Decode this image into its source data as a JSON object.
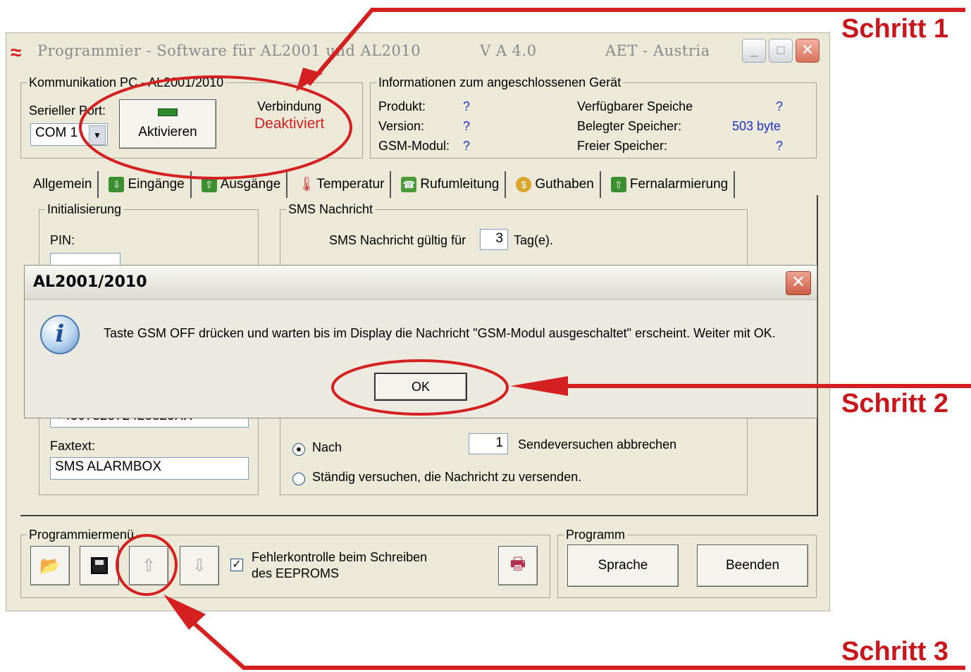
{
  "window": {
    "title_left": "Programmier - Software für AL2001 und AL2010",
    "title_version": "V A 4.0",
    "title_company": "AET - Austria"
  },
  "kommunikation": {
    "legend": "Kommunikation PC - AL2001/2010",
    "port_label": "Serieller Port:",
    "port_value": "COM 1",
    "activate_button": "Aktivieren",
    "verbindung_label": "Verbindung",
    "verbindung_status": "Deaktiviert"
  },
  "geraet": {
    "legend": "Informationen zum angeschlossenen Gerät",
    "produkt_label": "Produkt:",
    "produkt_value": "?",
    "version_label": "Version:",
    "version_value": "?",
    "gsm_label": "GSM-Modul:",
    "gsm_value": "?",
    "verfuegbar_label": "Verfügbarer Speiche",
    "verfuegbar_value": "?",
    "belegt_label": "Belegter Speicher:",
    "belegt_value": "503 byte",
    "frei_label": "Freier Speicher:",
    "frei_value": "?"
  },
  "tabs": [
    {
      "label": "Allgemein",
      "icon": "none"
    },
    {
      "label": "Eingänge",
      "icon": "arrow-in-icon"
    },
    {
      "label": "Ausgänge",
      "icon": "arrow-out-icon"
    },
    {
      "label": "Temperatur",
      "icon": "thermometer-icon"
    },
    {
      "label": "Rufumleitung",
      "icon": "phone-forward-icon"
    },
    {
      "label": "Guthaben",
      "icon": "coins-icon"
    },
    {
      "label": "Fernalarmierung",
      "icon": "remote-alarm-icon"
    }
  ],
  "allgemein": {
    "init_legend": "Initialisierung",
    "pin_label": "PIN:",
    "pin_value": "",
    "sms_legend": "SMS Nachricht",
    "sms_valid_prefix": "SMS Nachricht gültig für",
    "sms_valid_days": "3",
    "sms_valid_suffix": "Tag(e).",
    "number_partial": "+436782872428823XX",
    "faxtext_label": "Faxtext:",
    "faxtext_value": "SMS ALARMBOX",
    "radio_nach_label": "Nach",
    "send_attempts": "1",
    "send_attempts_suffix": "Sendeversuchen abbrechen",
    "radio_always_label": "Ständig versuchen, die Nachricht zu versenden."
  },
  "programmiermenu": {
    "legend": "Programmiermenü",
    "check_label_line1": "Fehlerkontrolle beim Schreiben",
    "check_label_line2": "des EEPROMS",
    "check_mark": "✓"
  },
  "programm": {
    "legend": "Programm",
    "sprache_button": "Sprache",
    "beenden_button": "Beenden"
  },
  "dialog": {
    "title": "AL2001/2010",
    "message": "Taste GSM OFF drücken und warten bis im Display die Nachricht \"GSM-Modul ausgeschaltet\" erscheint. Weiter mit OK.",
    "ok_button": "OK",
    "info_glyph": "i"
  },
  "annotations": {
    "step1": "Schritt 1",
    "step2": "Schritt 2",
    "step3": "Schritt 3",
    "color": "#c8161d"
  }
}
